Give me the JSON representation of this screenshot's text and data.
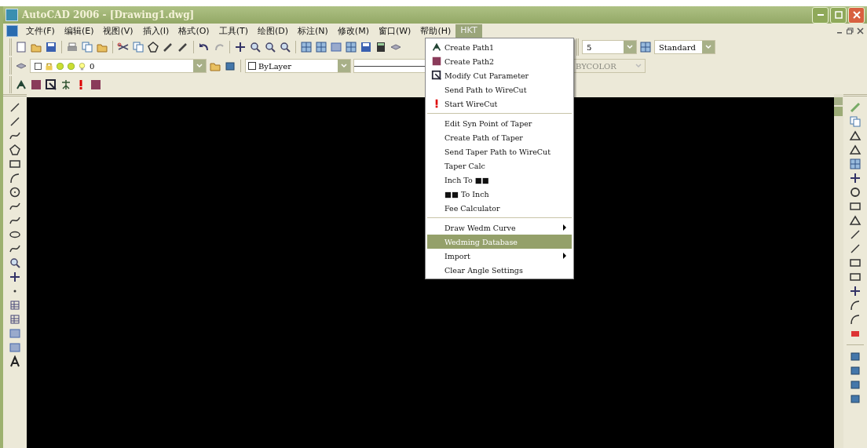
{
  "window": {
    "title": "AutoCAD 2006 - [Drawing1.dwg]"
  },
  "menu_bar": [
    {
      "label": "文件(F)",
      "selected": false
    },
    {
      "label": "编辑(E)",
      "selected": false
    },
    {
      "label": "视图(V)",
      "selected": false
    },
    {
      "label": "插入(I)",
      "selected": false
    },
    {
      "label": "格式(O)",
      "selected": false
    },
    {
      "label": "工具(T)",
      "selected": false
    },
    {
      "label": "绘图(D)",
      "selected": false
    },
    {
      "label": "标注(N)",
      "selected": false
    },
    {
      "label": "修改(M)",
      "selected": false
    },
    {
      "label": "窗口(W)",
      "selected": false
    },
    {
      "label": "帮助(H)",
      "selected": false
    },
    {
      "label": "HKT",
      "selected": true
    }
  ],
  "fields": [
    {
      "kind": "dim_style",
      "value": "5",
      "disabled": false
    },
    {
      "kind": "text_style",
      "value": "Standard",
      "disabled": false
    },
    {
      "kind": "layer",
      "value": "0",
      "disabled": false
    },
    {
      "kind": "color",
      "value": "ByLayer",
      "disabled": false
    },
    {
      "kind": "plot_style",
      "value": "BYCOLOR",
      "disabled": true
    }
  ],
  "dropdown_menu": [
    {
      "kind": "item",
      "label": "Create Path1",
      "submenu": false,
      "selected": false
    },
    {
      "kind": "item",
      "label": "Create Path2",
      "submenu": false,
      "selected": false
    },
    {
      "kind": "item",
      "label": "Modify Cut Parameter",
      "submenu": false,
      "selected": false
    },
    {
      "kind": "item",
      "label": "Send Path to WireCut",
      "submenu": false,
      "selected": false
    },
    {
      "kind": "item",
      "label": "Start WireCut",
      "submenu": false,
      "selected": false
    },
    {
      "kind": "separator"
    },
    {
      "kind": "item",
      "label": "Edit Syn Point of Taper",
      "submenu": false,
      "selected": false
    },
    {
      "kind": "item",
      "label": "Create Path of Taper",
      "submenu": false,
      "selected": false
    },
    {
      "kind": "item",
      "label": "Send Taper Path to WireCut",
      "submenu": false,
      "selected": false
    },
    {
      "kind": "item",
      "label": "Taper Calc",
      "submenu": false,
      "selected": false
    },
    {
      "kind": "item",
      "label": "Inch To ■■",
      "submenu": false,
      "selected": false
    },
    {
      "kind": "item",
      "label": "■■ To Inch",
      "submenu": false,
      "selected": false
    },
    {
      "kind": "item",
      "label": "Fee Calculator",
      "submenu": false,
      "selected": false
    },
    {
      "kind": "separator"
    },
    {
      "kind": "item",
      "label": "Draw Wedm Curve",
      "submenu": true,
      "selected": false
    },
    {
      "kind": "item",
      "label": "Wedming Database",
      "submenu": false,
      "selected": true
    },
    {
      "kind": "item",
      "label": "Import",
      "submenu": true,
      "selected": false
    },
    {
      "kind": "item",
      "label": "Clear Angle Settings",
      "submenu": false,
      "selected": false
    }
  ]
}
